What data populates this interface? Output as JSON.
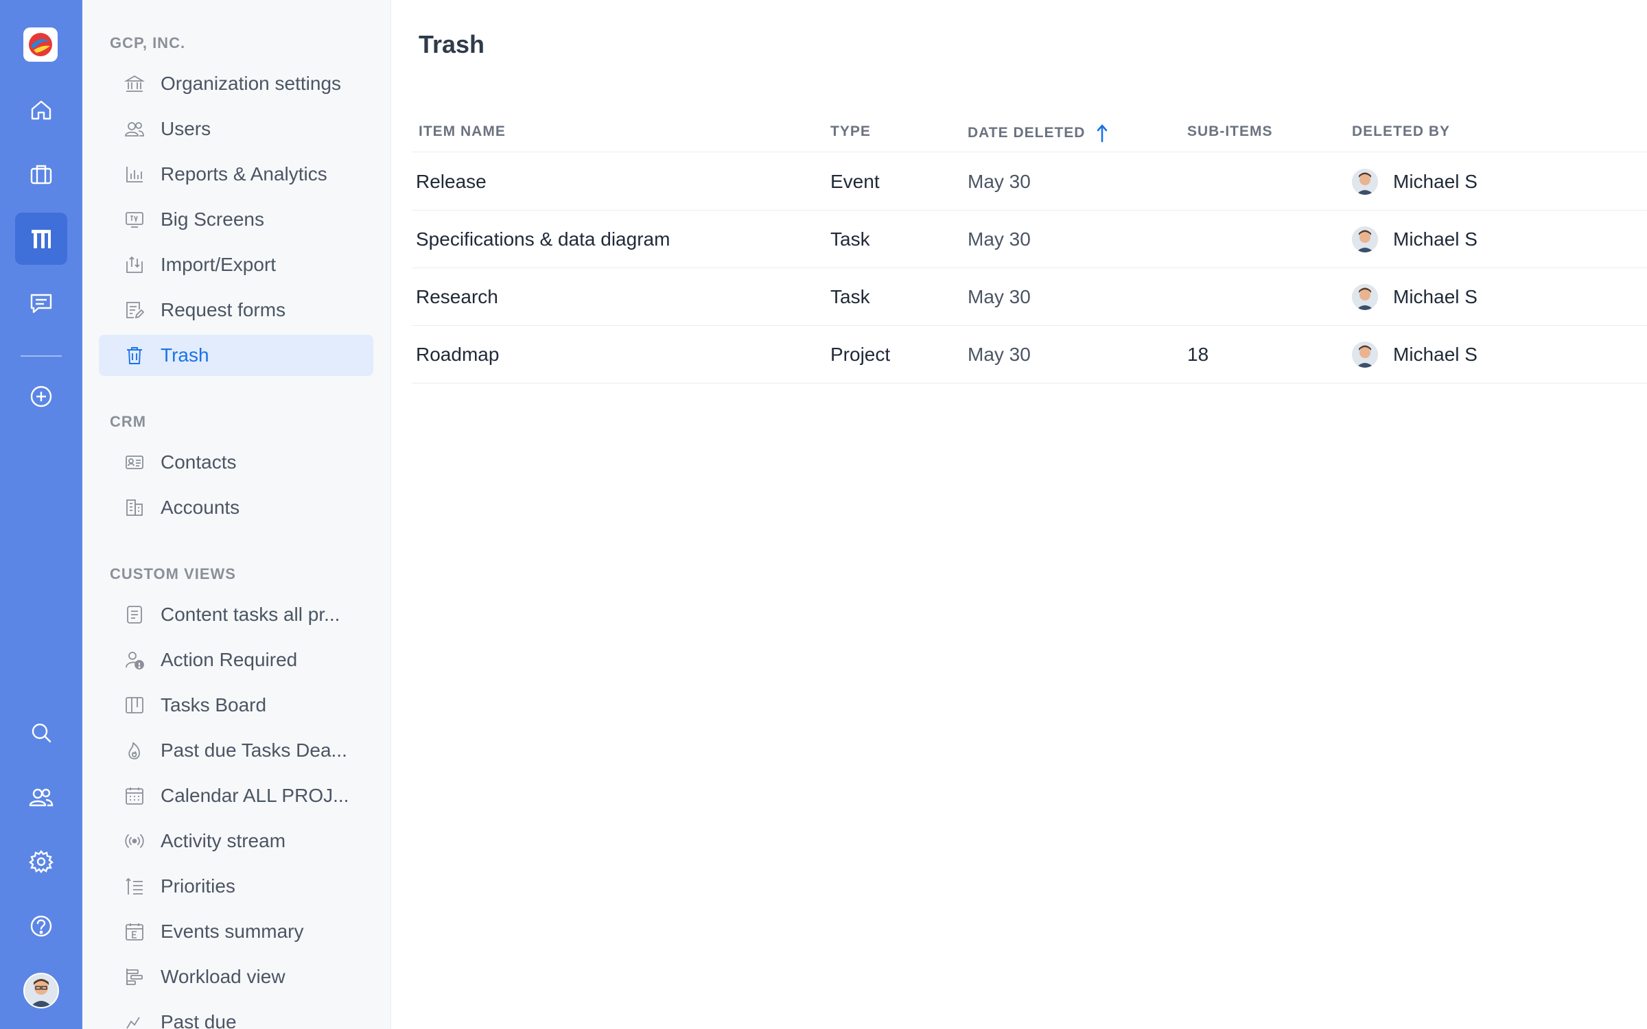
{
  "rail": {
    "icons": [
      "home-icon",
      "briefcase-icon",
      "workspace-icon",
      "chat-icon",
      "add-icon",
      "search-icon",
      "team-icon",
      "settings-icon",
      "help-icon"
    ],
    "accent": "#5b86e5",
    "active_bg": "#3f6fd8"
  },
  "sidebar": {
    "org_section": {
      "title": "GCP, INC.",
      "items": [
        {
          "label": "Organization settings",
          "icon": "bank-icon"
        },
        {
          "label": "Users",
          "icon": "users-icon"
        },
        {
          "label": "Reports & Analytics",
          "icon": "bar-chart-icon"
        },
        {
          "label": "Big Screens",
          "icon": "tv-icon"
        },
        {
          "label": "Import/Export",
          "icon": "import-export-icon"
        },
        {
          "label": "Request forms",
          "icon": "form-icon"
        },
        {
          "label": "Trash",
          "icon": "trash-icon",
          "active": true
        }
      ]
    },
    "crm_section": {
      "title": "CRM",
      "items": [
        {
          "label": "Contacts",
          "icon": "contact-card-icon"
        },
        {
          "label": "Accounts",
          "icon": "building-icon"
        }
      ]
    },
    "custom_section": {
      "title": "CUSTOM VIEWS",
      "items": [
        {
          "label": "Content tasks all pr...",
          "icon": "list-doc-icon"
        },
        {
          "label": "Action Required",
          "icon": "user-alert-icon"
        },
        {
          "label": "Tasks Board",
          "icon": "board-icon"
        },
        {
          "label": "Past due Tasks Dea...",
          "icon": "flame-icon"
        },
        {
          "label": "Calendar ALL PROJ...",
          "icon": "calendar-icon"
        },
        {
          "label": "Activity stream",
          "icon": "broadcast-icon"
        },
        {
          "label": "Priorities",
          "icon": "priorities-icon"
        },
        {
          "label": "Events summary",
          "icon": "event-calendar-icon"
        },
        {
          "label": "Workload view",
          "icon": "workload-icon"
        },
        {
          "label": "Past due",
          "icon": "chart-icon"
        }
      ]
    }
  },
  "main": {
    "title": "Trash",
    "columns": {
      "item_name": "ITEM NAME",
      "type": "TYPE",
      "date_deleted": "DATE DELETED",
      "sub_items": "SUB-ITEMS",
      "deleted_by": "DELETED BY"
    },
    "sort": {
      "column": "date_deleted",
      "direction": "ascending",
      "color": "#1a73e8"
    },
    "rows": [
      {
        "name": "Release",
        "type": "Event",
        "date": "May 30",
        "sub_items": "",
        "deleted_by": "Michael S"
      },
      {
        "name": "Specifications & data diagram",
        "type": "Task",
        "date": "May 30",
        "sub_items": "",
        "deleted_by": "Michael S"
      },
      {
        "name": "Research",
        "type": "Task",
        "date": "May 30",
        "sub_items": "",
        "deleted_by": "Michael S"
      },
      {
        "name": "Roadmap",
        "type": "Project",
        "date": "May 30",
        "sub_items": "18",
        "deleted_by": "Michael S"
      }
    ]
  }
}
